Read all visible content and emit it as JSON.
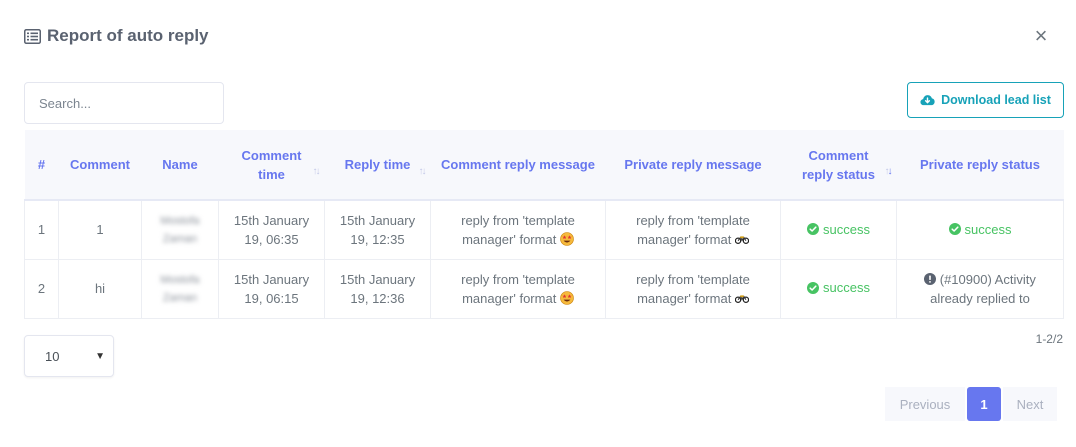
{
  "modal": {
    "title": "Report of auto reply",
    "close_label": "×"
  },
  "search": {
    "placeholder": "Search..."
  },
  "download_button": {
    "label": "Download lead list"
  },
  "table": {
    "headers": {
      "index": "#",
      "comment": "Comment",
      "name": "Name",
      "comment_time": "Comment time",
      "reply_time": "Reply time",
      "comment_reply_message": "Comment reply message",
      "private_reply_message": "Private reply message",
      "comment_reply_status": "Comment reply status",
      "private_reply_status": "Private reply status"
    },
    "rows": [
      {
        "index": "1",
        "comment": "1",
        "name": "Mostofa Zaman",
        "comment_time": "15th January 19, 06:35",
        "reply_time": "15th January 19, 12:35",
        "comment_reply_message": "reply from 'template manager' format",
        "private_reply_message": "reply from 'template manager' format",
        "comment_reply_status": "success",
        "private_reply_status": "success"
      },
      {
        "index": "2",
        "comment": "hi",
        "name": "Mostofa Zaman",
        "comment_time": "15th January 19, 06:15",
        "reply_time": "15th January 19, 12:36",
        "comment_reply_message": "reply from 'template manager' format",
        "private_reply_message": "reply from 'template manager' format",
        "comment_reply_status": "success",
        "private_reply_status": "(#10900) Activity already replied to"
      }
    ]
  },
  "page_size": {
    "selected": "10"
  },
  "range_info": "1-2/2",
  "pagination": {
    "previous": "Previous",
    "current": "1",
    "next": "Next"
  },
  "icons": {
    "title": "list-icon",
    "close": "close-icon",
    "download": "cloud-download-icon",
    "success": "check-circle-icon",
    "error": "exclamation-circle-icon",
    "comment_emoji": "star-struck-emoji-icon",
    "private_emoji": "motorcycle-emoji-icon"
  },
  "colors": {
    "accent": "#6777ef",
    "info": "#17a2b8",
    "success": "#47c363"
  }
}
